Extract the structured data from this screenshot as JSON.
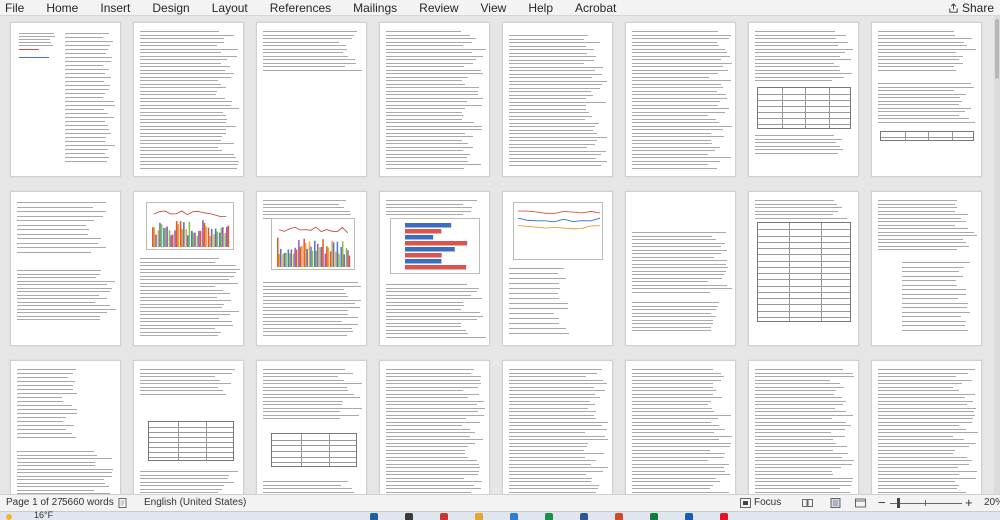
{
  "menu": {
    "items": [
      "File",
      "Home",
      "Insert",
      "Design",
      "Layout",
      "References",
      "Mailings",
      "Review",
      "View",
      "Help",
      "Acrobat"
    ],
    "share_label": "Share"
  },
  "status": {
    "page_indicator": "Page 1 of 27",
    "word_count": "5660 words",
    "language": "English (United States)",
    "focus_label": "Focus",
    "zoom_minus": "−",
    "zoom_plus": "+",
    "zoom_level": "20%"
  },
  "taskbar": {
    "weather_temp": "16°F"
  },
  "document": {
    "pages_visible": 24,
    "page_count": 27
  },
  "colors": {
    "ribbon_bg": "#f3f3f3",
    "doc_bg": "#e6e6e6",
    "page_bg": "#ffffff",
    "taskbar_bg": "#dfe6ee"
  },
  "icons": {
    "share": "share-icon",
    "document_check": "proofing-icon",
    "focus": "focus-icon",
    "read_mode": "read-mode-icon",
    "print_layout": "print-layout-icon",
    "web_layout": "web-layout-icon",
    "weather": "weather-sun-icon"
  }
}
